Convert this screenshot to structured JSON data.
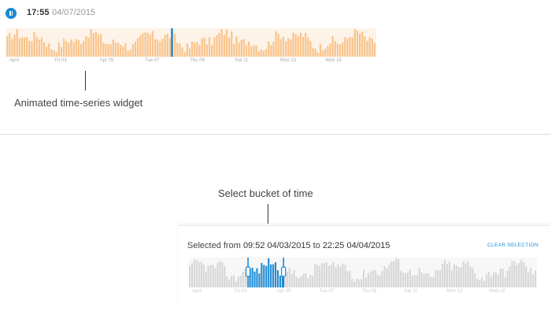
{
  "colors": {
    "accent": "#1a8ad4",
    "bar_orange": "#f8c48c",
    "bar_grey": "#d6d6d6",
    "bar_selected": "#1a8ad4"
  },
  "top_widget": {
    "pause_icon": "pause-icon",
    "time": "17:55",
    "date": "04/07/2015",
    "axis_labels": [
      "April",
      "Fri 03",
      "Apr 05",
      "Tue 07",
      "Thu 09",
      "Sat 11",
      "Mon 13",
      "Wed 15"
    ],
    "playhead_fraction": 0.445
  },
  "annotations": {
    "widget_caption": "Animated time-series widget",
    "bucket_caption": "Select bucket of time"
  },
  "bottom_widget": {
    "selected_prefix": "Selected from",
    "from_value": "09:52 04/03/2015",
    "to_word": "to",
    "to_value": "22:25 04/04/2015",
    "clear_label": "CLEAR SELECTION",
    "axis_labels": [
      "April",
      "Fri 03",
      "Apr 05",
      "Tue 07",
      "Thu 09",
      "Sat 11",
      "Mon 13",
      "Wed 15"
    ],
    "selection_start_fraction": 0.17,
    "selection_end_fraction": 0.272
  }
}
